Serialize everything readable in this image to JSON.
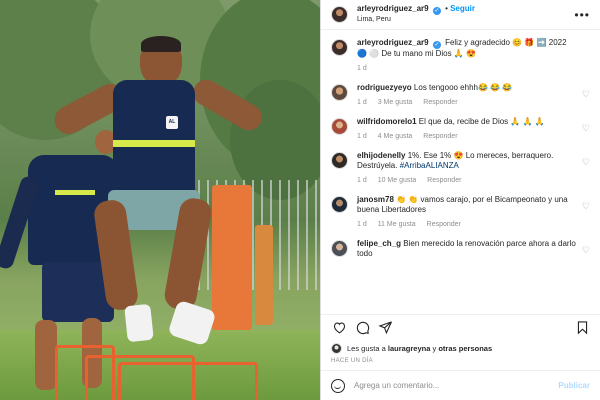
{
  "post": {
    "username": "arleyrodriguez_ar9",
    "follow_label": "Seguir",
    "location": "Lima, Peru",
    "more_label": "•••",
    "verified_mark": "✓",
    "photo_logo": "AL"
  },
  "caption": {
    "username": "arleyrodriguez_ar9",
    "text": "Feliz y agradecido 😊 🎁 ➡️ 2022 🔵 ⚪ De tu mano mi Dios 🙏 😍",
    "time": "1 d"
  },
  "comments": [
    {
      "username": "rodriguezyeyo",
      "text": "Los tengooo ehhh😂 😂 😂",
      "time": "1 d",
      "likes": "3 Me gusta",
      "reply": "Responder"
    },
    {
      "username": "wilfridomorelo1",
      "text": "El que da, recibe de Dios 🙏 🙏 🙏",
      "time": "1 d",
      "likes": "4 Me gusta",
      "reply": "Responder"
    },
    {
      "username": "elhijodenelly",
      "text": "1%. Ese 1% 😍 Lo mereces, berraquero. Destrúyela.",
      "tag": "#ArribaALIANZA",
      "time": "1 d",
      "likes": "10 Me gusta",
      "reply": "Responder"
    },
    {
      "username": "janosm78",
      "text": "👏 👏 vamos carajo, por el Bicampeonato y una buena Libertadores",
      "time": "1 d",
      "likes": "11 Me gusta",
      "reply": "Responder"
    },
    {
      "username": "felipe_ch_g",
      "text": "Bien merecido la renovación parce ahora a darlo todo",
      "time": "1 d",
      "likes": "",
      "reply": ""
    }
  ],
  "likes_text": {
    "prefix": "Les gusta a ",
    "user": "lauragreyna",
    "middle": " y ",
    "others": "otras personas"
  },
  "timestamp": "HACE UN DÍA",
  "add_comment": {
    "placeholder": "Agrega un comentario...",
    "publish_label": "Publicar"
  },
  "icons": [
    "heart-icon",
    "comment-icon",
    "share-icon",
    "bookmark-icon",
    "emoji-icon",
    "more-icon",
    "verified-icon"
  ],
  "colors": {
    "accent": "#0095f6",
    "publish_disabled": "#b3dbff",
    "muted": "#8e8e8e",
    "jersey": "#172a52",
    "stripe": "#d7e94a",
    "hurdle": "#e8622f"
  }
}
